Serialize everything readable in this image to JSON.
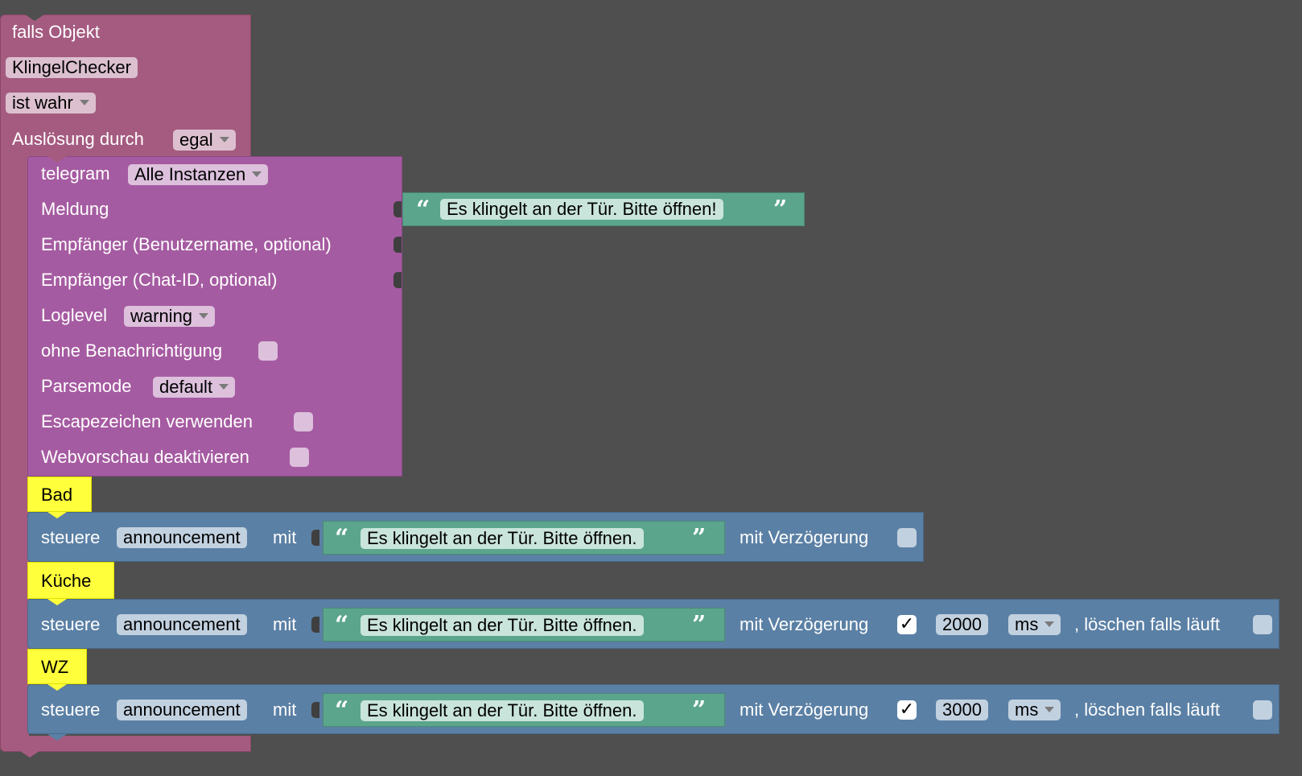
{
  "event_block": {
    "title": "falls Objekt",
    "object_id": "KlingelChecker",
    "condition": "ist wahr",
    "trigger_label": "Auslösung durch",
    "trigger_value": "egal"
  },
  "telegram_block": {
    "label": "telegram",
    "instance": "Alle Instanzen",
    "message_label": "Meldung",
    "message_value": "Es klingelt an der Tür. Bitte öffnen!",
    "recipient_user_label": "Empfänger (Benutzername, optional)",
    "recipient_chat_label": "Empfänger (Chat-ID, optional)",
    "loglevel_label": "Loglevel",
    "loglevel_value": "warning",
    "silent_label": "ohne Benachrichtigung",
    "parsemode_label": "Parsemode",
    "parsemode_value": "default",
    "escape_label": "Escapezeichen verwenden",
    "webpreview_label": "Webvorschau deaktivieren"
  },
  "quote_open": "“",
  "quote_close": "”",
  "checkmark": "✓",
  "controls": [
    {
      "comment": "Bad",
      "verb": "steuere",
      "state": "announcement",
      "with_label": "mit",
      "text": "Es klingelt an der Tür. Bitte öffnen.",
      "delay_label": "mit Verzögerung"
    },
    {
      "comment": "Küche",
      "verb": "steuere",
      "state": "announcement",
      "with_label": "mit",
      "text": "Es klingelt an der Tür. Bitte öffnen.",
      "delay_label": "mit Verzögerung",
      "delay_value": "2000",
      "unit": "ms",
      "clear_label": ", löschen falls läuft"
    },
    {
      "comment": "WZ",
      "verb": "steuere",
      "state": "announcement",
      "with_label": "mit",
      "text": "Es klingelt an der Tür. Bitte öffnen.",
      "delay_label": "mit Verzögerung",
      "delay_value": "3000",
      "unit": "ms",
      "clear_label": ", löschen falls läuft"
    }
  ],
  "colors": {
    "event": "#a55b80",
    "telegram": "#a55ba1",
    "text": "#5ba58c",
    "control": "#5b80a5",
    "comment": "#ffff3c",
    "workspace": "#4f4f4f"
  }
}
